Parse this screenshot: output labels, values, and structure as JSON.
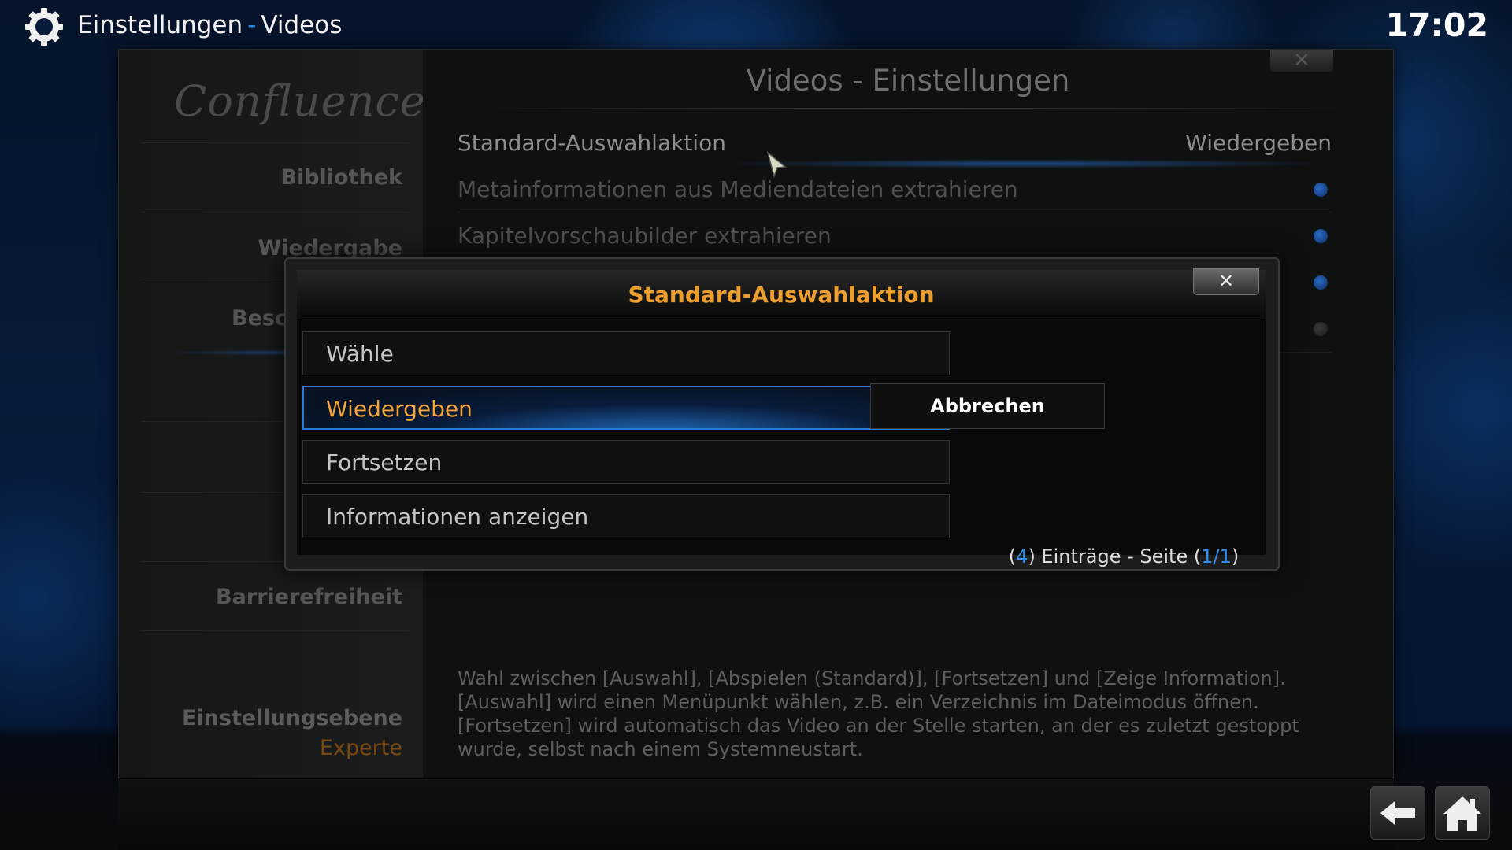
{
  "header": {
    "title": "Einstellungen",
    "separator": "-",
    "subtitle": "Videos",
    "clock": "17:02",
    "icon": "gear-icon"
  },
  "main": {
    "title": "Videos - Einstellungen",
    "logo_text": "Confluence",
    "sidebar": {
      "items": [
        "Bibliothek",
        "Wiedergabe",
        "Besch",
        "Barrierefreiheit"
      ],
      "level_label": "Einstellungsebene",
      "level_value": "Experte"
    },
    "settings": [
      {
        "label": "Standard-Auswahlaktion",
        "value": "Wiedergeben"
      },
      {
        "label": "Metainformationen aus Mediendateien extrahieren",
        "value": ""
      },
      {
        "label": "Kapitelvorschaubilder extrahieren",
        "value": ""
      }
    ],
    "description": "Wahl zwischen [Auswahl], [Abspielen (Standard)], [Fortsetzen] und [Zeige Information]. [Auswahl] wird einen Menüpunkt wählen, z.B. ein Verzeichnis im Dateimodus öffnen. [Fortsetzen] wird automatisch das Video an der Stelle starten, an der es zuletzt gestoppt wurde, selbst nach einem Systemneustart.",
    "close_glyph": "✕"
  },
  "dialog": {
    "title": "Standard-Auswahlaktion",
    "close_glyph": "✕",
    "options": [
      "Wähle",
      "Wiedergeben",
      "Fortsetzen",
      "Informationen anzeigen"
    ],
    "selected_index": 1,
    "cancel_label": "Abbrechen",
    "pager": {
      "open_paren": "(",
      "count": "4",
      "middle": ") Einträge - Seite (",
      "page": "1/1",
      "close_paren": ")"
    }
  },
  "bottom": {
    "back_icon": "back-arrow-icon",
    "home_icon": "home-icon"
  },
  "colors": {
    "accent_orange": "#eb9e2e",
    "accent_blue": "#2f8df0"
  }
}
